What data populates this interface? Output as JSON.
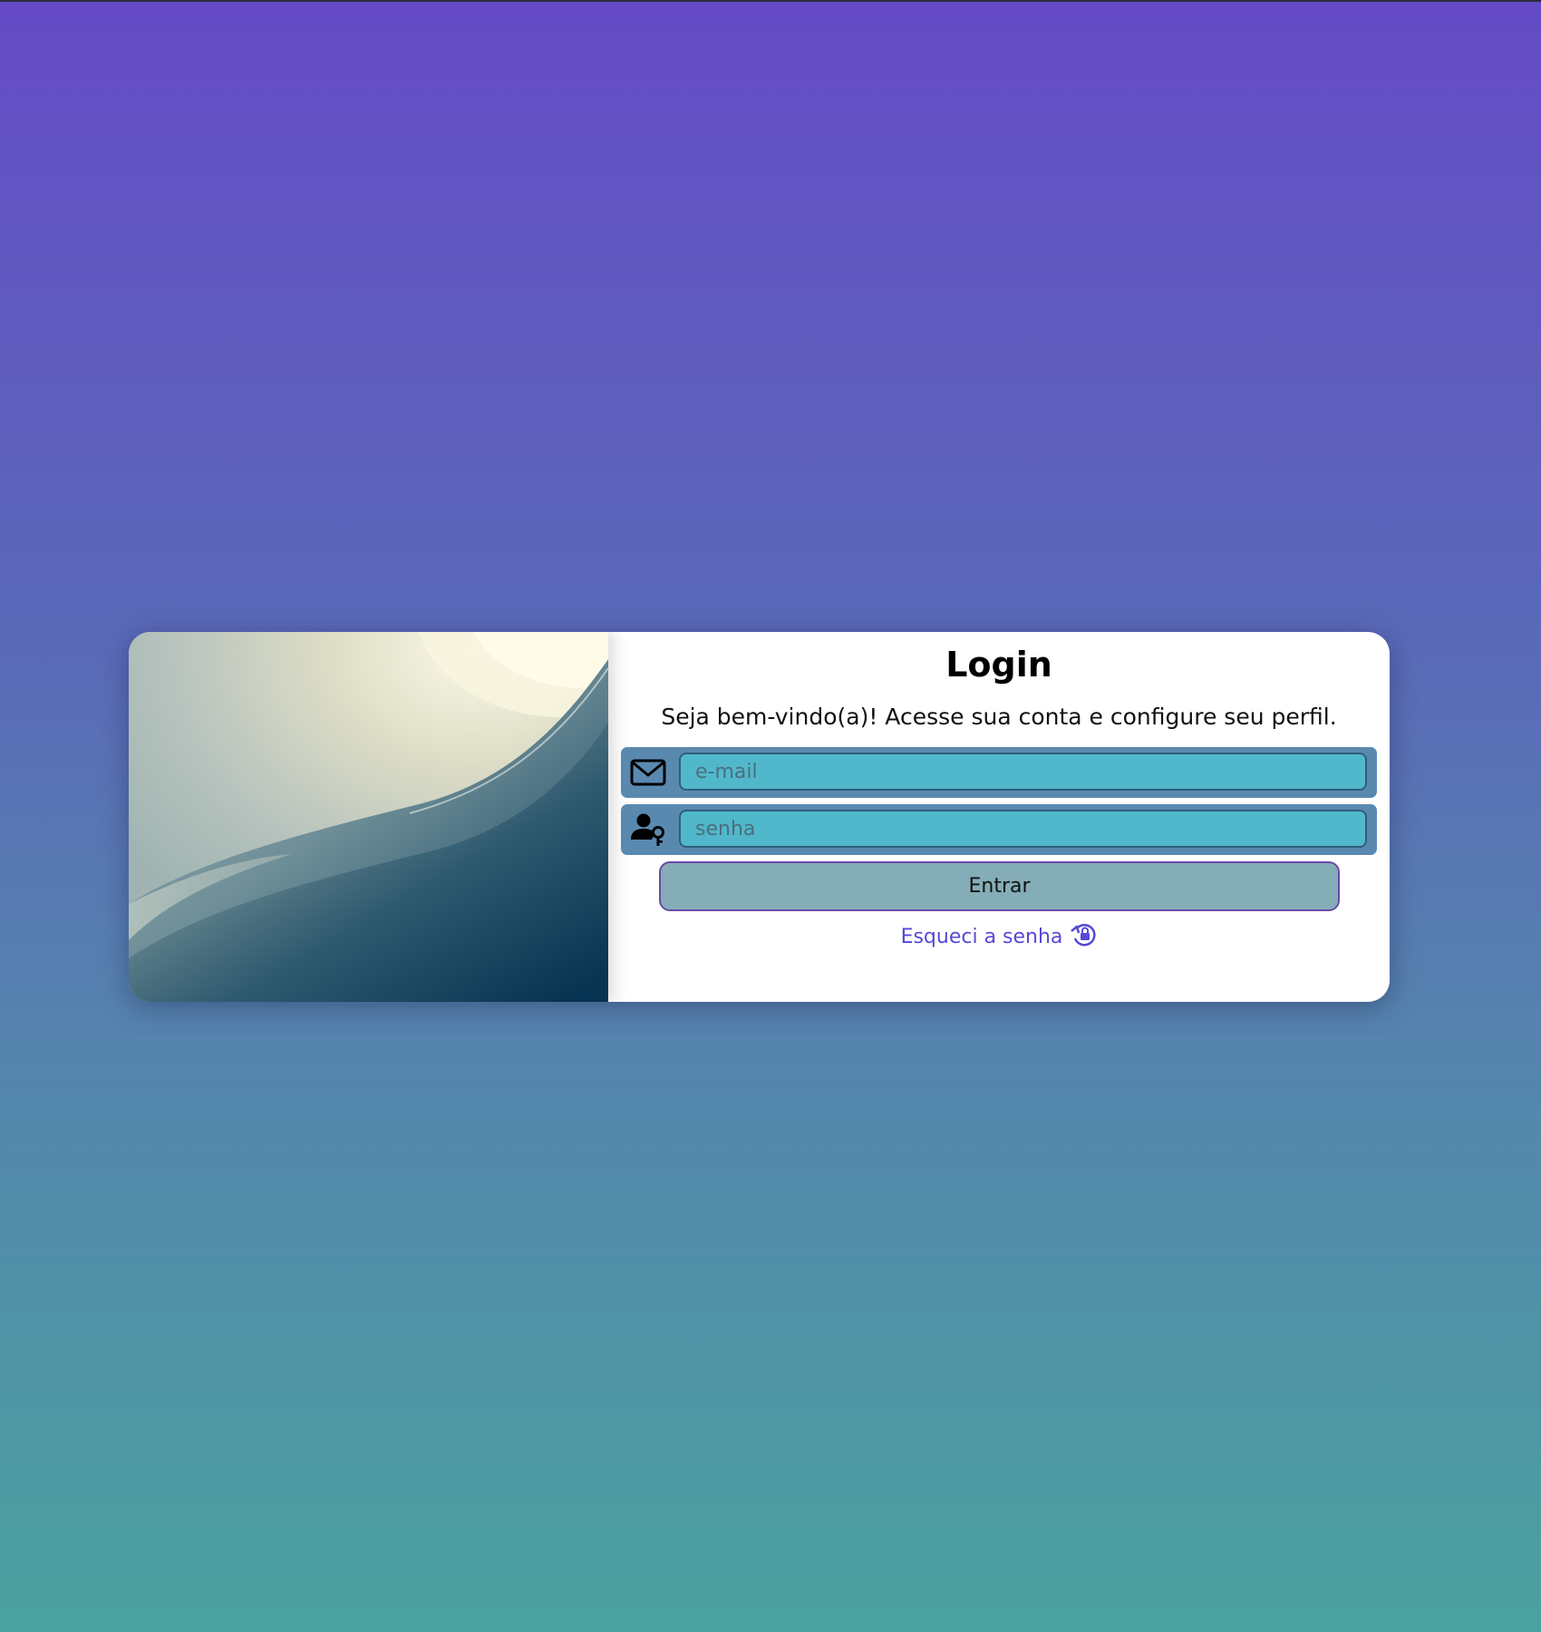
{
  "login": {
    "title": "Login",
    "subtitle": "Seja bem-vindo(a)! Acesse sua conta e configure seu perfil.",
    "email_placeholder": "e-mail",
    "password_placeholder": "senha",
    "submit_label": "Entrar",
    "forgot_label": "Esqueci a senha"
  },
  "icons": {
    "email": "envelope-icon",
    "password": "user-key-icon",
    "forgot": "lock-reset-icon"
  },
  "colors": {
    "background_top": "#654bc6",
    "background_bottom": "#4aa29e",
    "field_frame": "#5a89b0",
    "input_fill": "#51b8cb",
    "button_fill": "#84adb7",
    "button_border": "#6a4aa8",
    "link": "#5648d6"
  }
}
